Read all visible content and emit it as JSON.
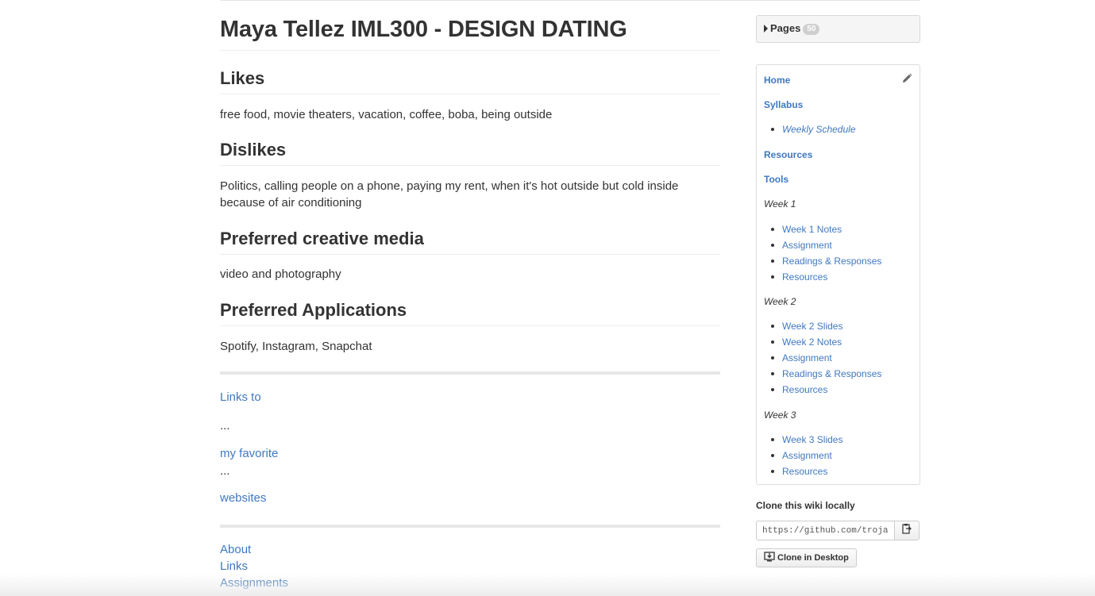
{
  "page": {
    "title": "Maya Tellez IML300 - DESIGN DATING",
    "sections": [
      {
        "heading": "Likes",
        "text": "free food, movie theaters, vacation, coffee, boba, being outside"
      },
      {
        "heading": "Dislikes",
        "text": "Politics, calling people on a phone, paying my rent, when it's hot outside but cold inside because of air conditioning"
      },
      {
        "heading": "Preferred creative media",
        "text": "video and photography"
      },
      {
        "heading": "Preferred Applications",
        "text": "Spotify, Instagram, Snapchat"
      }
    ],
    "links_block": {
      "link1": "Links to",
      "dots1": "...",
      "link2": "my favorite",
      "dots2": "...",
      "link3": "websites"
    },
    "footer_links": [
      "About",
      "Links",
      "Assignments"
    ]
  },
  "sidebar": {
    "pages_label": "Pages",
    "pages_count": "50",
    "nav": {
      "home": "Home",
      "syllabus": "Syllabus",
      "weekly_schedule": "Weekly Schedule",
      "resources": "Resources",
      "tools": "Tools",
      "week1": {
        "label": "Week 1",
        "items": [
          "Week 1 Notes",
          "Assignment",
          "Readings & Responses",
          "Resources"
        ]
      },
      "week2": {
        "label": "Week 2",
        "items": [
          "Week 2 Slides",
          "Week 2 Notes",
          "Assignment",
          "Readings & Responses",
          "Resources"
        ]
      },
      "week3": {
        "label": "Week 3",
        "items": [
          "Week 3 Slides",
          "Assignment",
          "Resources"
        ]
      }
    },
    "clone": {
      "title": "Clone this wiki locally",
      "url": "https://github.com/trojan",
      "desktop_label": "Clone in Desktop"
    }
  }
}
